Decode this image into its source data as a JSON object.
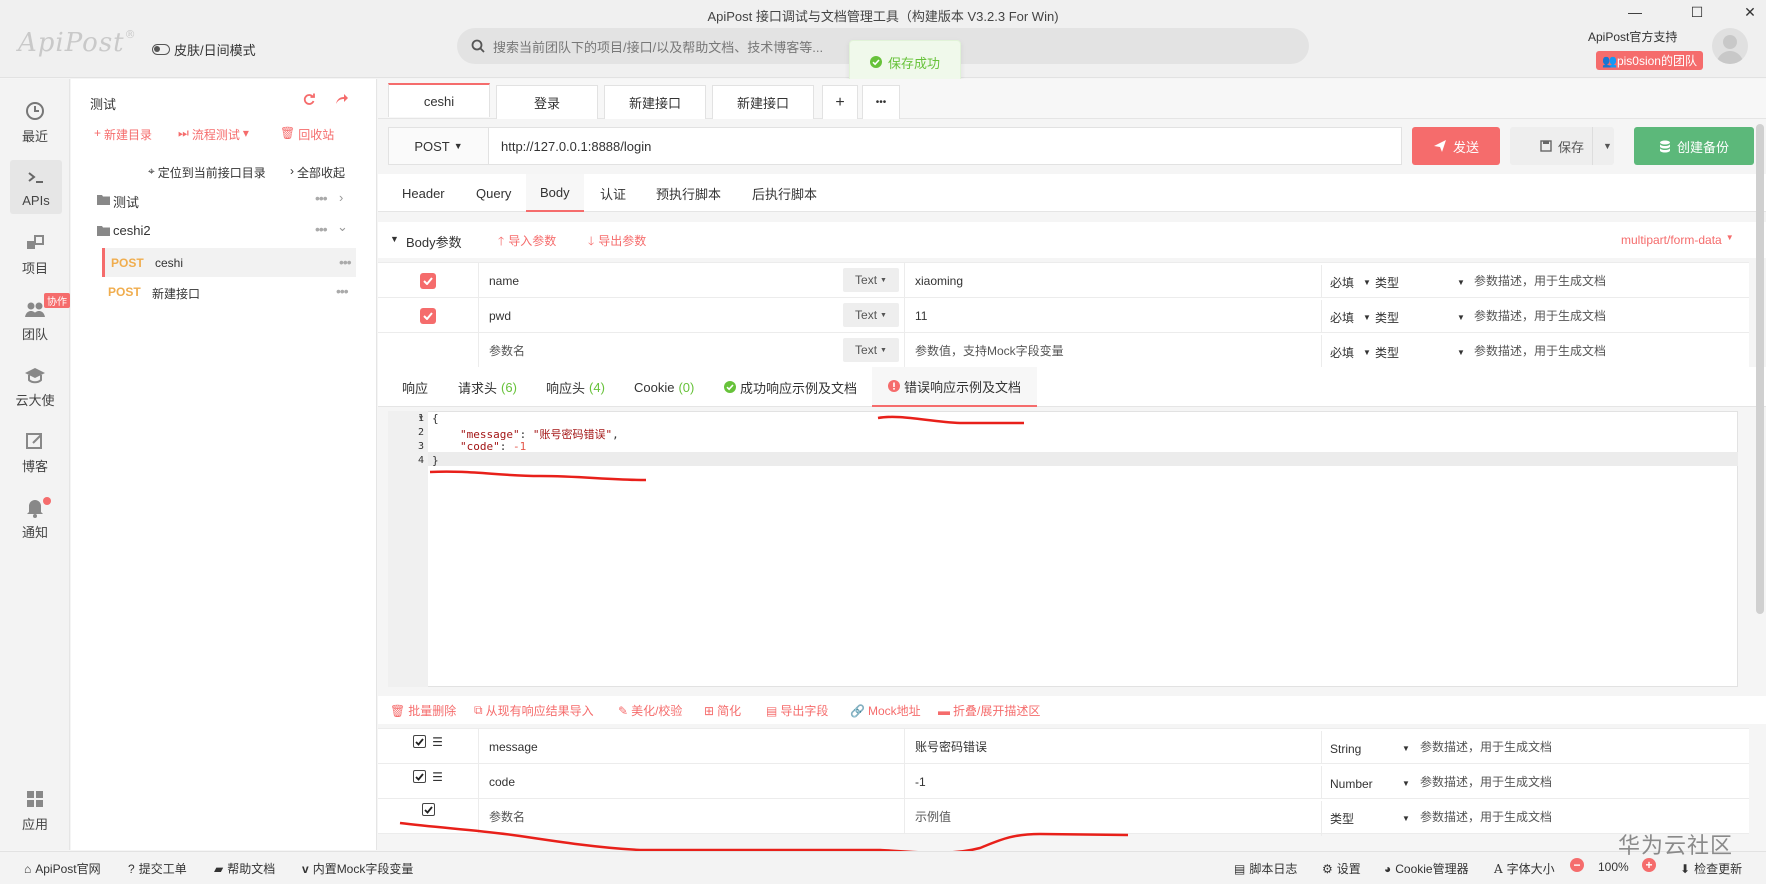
{
  "window": {
    "title": "ApiPost 接口调试与文档管理工具（构建版本 V3.2.3 For Win)",
    "logo": "ApiPost",
    "logo_mark": "®",
    "skin_toggle": "皮肤/日间模式",
    "search_placeholder": "搜索当前团队下的项目/接口/以及帮助文档、技术博客等...",
    "toast": "保存成功",
    "support": "ApiPost官方支持",
    "team": "pis0sion的团队"
  },
  "nav": {
    "recent": "最近",
    "apis": "APIs",
    "project": "项目",
    "team": "团队",
    "team_badge": "协作",
    "cloud": "云大使",
    "blog": "博客",
    "notify": "通知",
    "apps": "应用"
  },
  "tree": {
    "root": "测试",
    "new_dir": "新建目录",
    "flow_test": "流程测试",
    "recycle": "回收站",
    "locate": "定位到当前接口目录",
    "collapse": "全部收起",
    "folders": [
      "测试",
      "ceshi2"
    ],
    "apis": [
      {
        "method": "POST",
        "name": "ceshi"
      },
      {
        "method": "POST",
        "name": "新建接口"
      }
    ]
  },
  "tabs": [
    "ceshi",
    "登录",
    "新建接口",
    "新建接口"
  ],
  "tab_plus": "+",
  "tab_more": "•••",
  "request": {
    "method": "POST",
    "url": "http://127.0.0.1:8888/login",
    "send": "发送",
    "save": "保存",
    "backup": "创建备份"
  },
  "req_tabs": [
    "Header",
    "Query",
    "Body",
    "认证",
    "预执行脚本",
    "后执行脚本"
  ],
  "body": {
    "title": "Body参数",
    "import": "导入参数",
    "export": "导出参数",
    "content_type": "multipart/form-data",
    "rows": [
      {
        "name": "name",
        "type_btn": "Text",
        "value": "xiaoming",
        "required": "必填",
        "type": "类型",
        "desc": "参数描述，用于生成文档",
        "checked": true
      },
      {
        "name": "pwd",
        "type_btn": "Text",
        "value": "11",
        "required": "必填",
        "type": "类型",
        "desc": "参数描述，用于生成文档",
        "checked": true
      },
      {
        "name": "参数名",
        "type_btn": "Text",
        "value": "参数值，支持Mock字段变量",
        "required": "必填",
        "type": "类型",
        "desc": "参数描述，用于生成文档",
        "checked": false
      }
    ]
  },
  "resp_tabs": {
    "response": "响应",
    "req_headers": "请求头",
    "req_headers_count": "(6)",
    "resp_headers": "响应头",
    "resp_headers_count": "(4)",
    "cookie": "Cookie",
    "cookie_count": "(0)",
    "success_doc": "成功响应示例及文档",
    "error_doc": "错误响应示例及文档"
  },
  "editor": {
    "lines": [
      "1",
      "2",
      "3",
      "4"
    ],
    "open": "{",
    "k1": "\"message\"",
    "v1": "\"账号密码错误\"",
    "k2": "\"code\"",
    "v2": "-1",
    "close": "}"
  },
  "resp_tools": [
    "批量删除",
    "从现有响应结果导入",
    "美化/校验",
    "简化",
    "导出字段",
    "Mock地址",
    "折叠/展开描述区"
  ],
  "resp_fields": [
    {
      "name": "message",
      "value": "账号密码错误",
      "type": "String",
      "desc": "参数描述，用于生成文档"
    },
    {
      "name": "code",
      "value": "-1",
      "type": "Number",
      "desc": "参数描述，用于生成文档"
    },
    {
      "name": "参数名",
      "value": "示例值",
      "type": "类型",
      "desc": "参数描述，用于生成文档"
    }
  ],
  "status": {
    "site": "ApiPost官网",
    "ticket": "提交工单",
    "help": "帮助文档",
    "mock": "内置Mock字段变量",
    "script_log": "脚本日志",
    "settings": "设置",
    "cookie_mgr": "Cookie管理器",
    "font_size": "字体大小",
    "zoom": "100%",
    "update": "检查更新"
  },
  "watermark": "华为云社区",
  "colors": {
    "accent": "#f56c6c",
    "success": "#5cb87a",
    "post": "#f0ad4e"
  }
}
